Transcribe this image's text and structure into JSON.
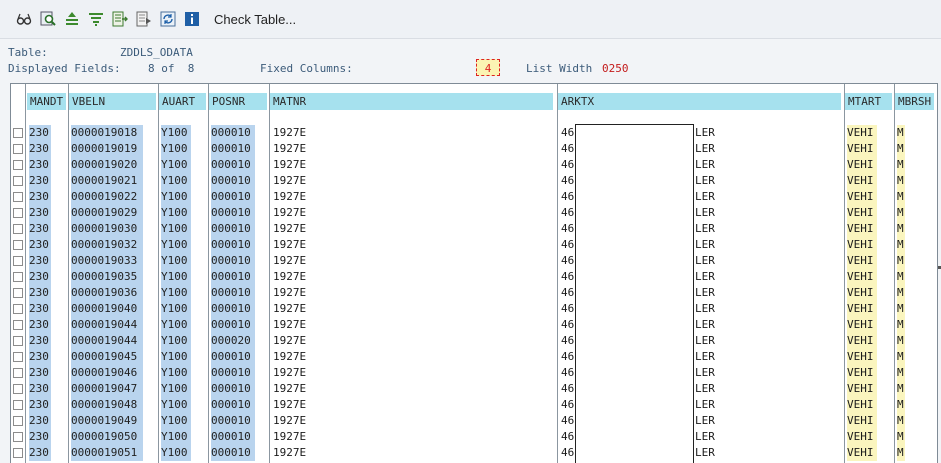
{
  "toolbar": {
    "icons": [
      "glasses-icon",
      "find-icon",
      "sort-ascending-icon",
      "filter-icon",
      "export-icon",
      "choose-layout-icon",
      "refresh-icon",
      "info-icon"
    ],
    "check_table_label": "Check Table..."
  },
  "header": {
    "table_label": "Table:",
    "table_value": "ZDDLS_ODATA",
    "fields_label": "Displayed Fields:",
    "fields_value": "8 of  8",
    "fixed_label": "Fixed Columns:",
    "fixed_value": "4",
    "width_label": "List Width",
    "width_value": "0250"
  },
  "columns": [
    "MANDT",
    "VBELN",
    "AUART",
    "POSNR",
    "MATNR",
    "ARKTX",
    "MTART",
    "MBRSH"
  ],
  "rows": [
    {
      "mandt": "230",
      "vbeln": "0000019018",
      "auart": "Y100",
      "posnr": "000010",
      "matnr": "1927E",
      "arktx_a": "46",
      "arktx_b": "LER",
      "mtart": "VEHI",
      "mbrsh": "M"
    },
    {
      "mandt": "230",
      "vbeln": "0000019019",
      "auart": "Y100",
      "posnr": "000010",
      "matnr": "1927E",
      "arktx_a": "46",
      "arktx_b": "LER",
      "mtart": "VEHI",
      "mbrsh": "M"
    },
    {
      "mandt": "230",
      "vbeln": "0000019020",
      "auart": "Y100",
      "posnr": "000010",
      "matnr": "1927E",
      "arktx_a": "46",
      "arktx_b": "LER",
      "mtart": "VEHI",
      "mbrsh": "M"
    },
    {
      "mandt": "230",
      "vbeln": "0000019021",
      "auart": "Y100",
      "posnr": "000010",
      "matnr": "1927E",
      "arktx_a": "46",
      "arktx_b": "LER",
      "mtart": "VEHI",
      "mbrsh": "M"
    },
    {
      "mandt": "230",
      "vbeln": "0000019022",
      "auart": "Y100",
      "posnr": "000010",
      "matnr": "1927E",
      "arktx_a": "46",
      "arktx_b": "LER",
      "mtart": "VEHI",
      "mbrsh": "M"
    },
    {
      "mandt": "230",
      "vbeln": "0000019029",
      "auart": "Y100",
      "posnr": "000010",
      "matnr": "1927E",
      "arktx_a": "46",
      "arktx_b": "LER",
      "mtart": "VEHI",
      "mbrsh": "M"
    },
    {
      "mandt": "230",
      "vbeln": "0000019030",
      "auart": "Y100",
      "posnr": "000010",
      "matnr": "1927E",
      "arktx_a": "46",
      "arktx_b": "LER",
      "mtart": "VEHI",
      "mbrsh": "M"
    },
    {
      "mandt": "230",
      "vbeln": "0000019032",
      "auart": "Y100",
      "posnr": "000010",
      "matnr": "1927E",
      "arktx_a": "46",
      "arktx_b": "LER",
      "mtart": "VEHI",
      "mbrsh": "M"
    },
    {
      "mandt": "230",
      "vbeln": "0000019033",
      "auart": "Y100",
      "posnr": "000010",
      "matnr": "1927E",
      "arktx_a": "46",
      "arktx_b": "LER",
      "mtart": "VEHI",
      "mbrsh": "M"
    },
    {
      "mandt": "230",
      "vbeln": "0000019035",
      "auart": "Y100",
      "posnr": "000010",
      "matnr": "1927E",
      "arktx_a": "46",
      "arktx_b": "LER",
      "mtart": "VEHI",
      "mbrsh": "M"
    },
    {
      "mandt": "230",
      "vbeln": "0000019036",
      "auart": "Y100",
      "posnr": "000010",
      "matnr": "1927E",
      "arktx_a": "46",
      "arktx_b": "LER",
      "mtart": "VEHI",
      "mbrsh": "M"
    },
    {
      "mandt": "230",
      "vbeln": "0000019040",
      "auart": "Y100",
      "posnr": "000010",
      "matnr": "1927E",
      "arktx_a": "46",
      "arktx_b": "LER",
      "mtart": "VEHI",
      "mbrsh": "M"
    },
    {
      "mandt": "230",
      "vbeln": "0000019044",
      "auart": "Y100",
      "posnr": "000010",
      "matnr": "1927E",
      "arktx_a": "46",
      "arktx_b": "LER",
      "mtart": "VEHI",
      "mbrsh": "M"
    },
    {
      "mandt": "230",
      "vbeln": "0000019044",
      "auart": "Y100",
      "posnr": "000020",
      "matnr": "1927E",
      "arktx_a": "46",
      "arktx_b": "LER",
      "mtart": "VEHI",
      "mbrsh": "M"
    },
    {
      "mandt": "230",
      "vbeln": "0000019045",
      "auart": "Y100",
      "posnr": "000010",
      "matnr": "1927E",
      "arktx_a": "46",
      "arktx_b": "LER",
      "mtart": "VEHI",
      "mbrsh": "M"
    },
    {
      "mandt": "230",
      "vbeln": "0000019046",
      "auart": "Y100",
      "posnr": "000010",
      "matnr": "1927E",
      "arktx_a": "46",
      "arktx_b": "LER",
      "mtart": "VEHI",
      "mbrsh": "M"
    },
    {
      "mandt": "230",
      "vbeln": "0000019047",
      "auart": "Y100",
      "posnr": "000010",
      "matnr": "1927E",
      "arktx_a": "46",
      "arktx_b": "LER",
      "mtart": "VEHI",
      "mbrsh": "M"
    },
    {
      "mandt": "230",
      "vbeln": "0000019048",
      "auart": "Y100",
      "posnr": "000010",
      "matnr": "1927E",
      "arktx_a": "46",
      "arktx_b": "LER",
      "mtart": "VEHI",
      "mbrsh": "M"
    },
    {
      "mandt": "230",
      "vbeln": "0000019049",
      "auart": "Y100",
      "posnr": "000010",
      "matnr": "1927E",
      "arktx_a": "46",
      "arktx_b": "LER",
      "mtart": "VEHI",
      "mbrsh": "M"
    },
    {
      "mandt": "230",
      "vbeln": "0000019050",
      "auart": "Y100",
      "posnr": "000010",
      "matnr": "1927E",
      "arktx_a": "46",
      "arktx_b": "LER",
      "mtart": "VEHI",
      "mbrsh": "M"
    },
    {
      "mandt": "230",
      "vbeln": "0000019051",
      "auart": "Y100",
      "posnr": "000010",
      "matnr": "1927E",
      "arktx_a": "46",
      "arktx_b": "LER",
      "mtart": "VEHI",
      "mbrsh": "M"
    }
  ]
}
